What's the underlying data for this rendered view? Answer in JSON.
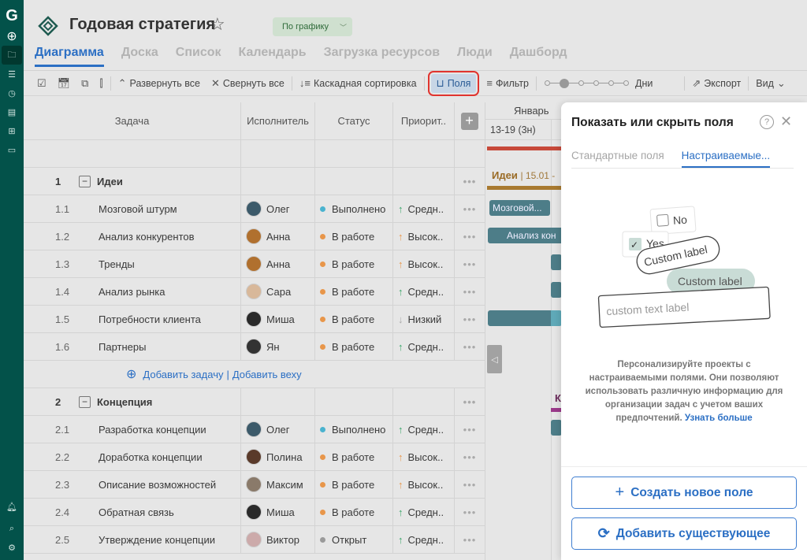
{
  "app": {
    "logo": "G"
  },
  "header": {
    "title": "Годовая стратегия",
    "status": "По графику"
  },
  "tabs": [
    "Диаграмма",
    "Доска",
    "Список",
    "Календарь",
    "Загрузка ресурсов",
    "Люди",
    "Дашборд"
  ],
  "toolbar": {
    "expand": "Развернуть все",
    "collapse": "Свернуть все",
    "sort": "Каскадная сортировка",
    "fields": "Поля",
    "filter": "Фильтр",
    "zoom_label": "Дни",
    "zoom_level": "2 of 6",
    "export": "Экспорт",
    "view": "Вид"
  },
  "columns": {
    "task": "Задача",
    "assignee": "Исполнитель",
    "status": "Статус",
    "priority": "Приорит.."
  },
  "groups": [
    {
      "num": "1",
      "name": "Идеи",
      "rows": [
        {
          "num": "1.1",
          "task": "Мозговой штурм",
          "assignee": "Олег",
          "status": "Выполнено",
          "priority": "Средн.."
        },
        {
          "num": "1.2",
          "task": "Анализ конкурентов",
          "assignee": "Анна",
          "status": "В работе",
          "priority": "Высок.."
        },
        {
          "num": "1.3",
          "task": "Тренды",
          "assignee": "Анна",
          "status": "В работе",
          "priority": "Высок.."
        },
        {
          "num": "1.4",
          "task": "Анализ рынка",
          "assignee": "Сара",
          "status": "В работе",
          "priority": "Средн.."
        },
        {
          "num": "1.5",
          "task": "Потребности клиента",
          "assignee": "Миша",
          "status": "В работе",
          "priority": "Низкий"
        },
        {
          "num": "1.6",
          "task": "Партнеры",
          "assignee": "Ян",
          "status": "В работе",
          "priority": "Средн.."
        }
      ]
    },
    {
      "num": "2",
      "name": "Концепция",
      "rows": [
        {
          "num": "2.1",
          "task": "Разработка концепции",
          "assignee": "Олег",
          "status": "Выполнено",
          "priority": "Средн.."
        },
        {
          "num": "2.2",
          "task": "Доработка концепции",
          "assignee": "Полина",
          "status": "В работе",
          "priority": "Высок.."
        },
        {
          "num": "2.3",
          "task": "Описание возможностей",
          "assignee": "Максим",
          "status": "В работе",
          "priority": "Высок.."
        },
        {
          "num": "2.4",
          "task": "Обратная связь",
          "assignee": "Миша",
          "status": "В работе",
          "priority": "Средн.."
        },
        {
          "num": "2.5",
          "task": "Утверждение концепции",
          "assignee": "Виктор",
          "status": "Открыт",
          "priority": "Средн.."
        }
      ]
    }
  ],
  "add": {
    "task": "Добавить задачу",
    "milestone": "Добавить веху"
  },
  "gantt": {
    "month": "Январь",
    "week": "13-19 (3н)",
    "group1": "Идеи",
    "group1_date": "15.01 -",
    "group2": "К",
    "bar1": "Мозговой...",
    "bar2": "Анализ кон"
  },
  "panel": {
    "title": "Показать или скрыть поля",
    "tab_standard": "Стандартные поля",
    "tab_custom": "Настраиваемые...",
    "illu": {
      "no": "No",
      "yes": "Yes",
      "label1": "Custom label",
      "label2": "Custom label",
      "text": "custom text label"
    },
    "desc": "Персонализируйте проекты с настраиваемыми полями. Они позволяют использовать различную информацию для организации задач с учетом ваших предпочтений.",
    "learn_more": "Узнать больше",
    "create": "Создать новое поле",
    "add_existing": "Добавить существующее"
  },
  "colors": {
    "sidebar": "#03524a",
    "accent": "#2b6fc4",
    "done": "#4ab3cf",
    "in_progress": "#e8964a",
    "open": "#9a9a9a",
    "prio_up_green": "#3aa66a",
    "prio_up_orange": "#e8964a",
    "bar": "#4d7d88",
    "highlight": "#e0342f"
  }
}
